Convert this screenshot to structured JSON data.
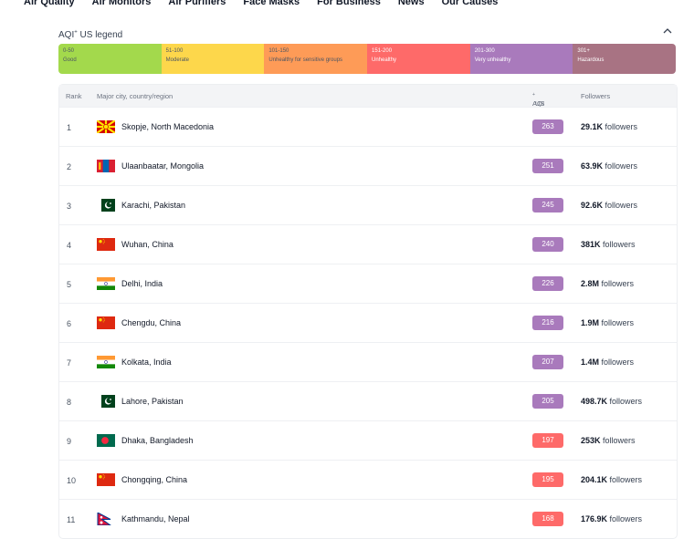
{
  "nav": [
    "Air Quality",
    "Air Monitors",
    "Air Purifiers",
    "Face Masks",
    "For Business",
    "News",
    "Our Causes"
  ],
  "legend": {
    "title": "AQI",
    "title_sup": "+",
    "title_suffix": " US legend",
    "segments": [
      {
        "range": "0-50",
        "label": "Good",
        "color": "#a3d94c",
        "text": "light"
      },
      {
        "range": "51-100",
        "label": "Moderate",
        "color": "#fdd74b",
        "text": "light"
      },
      {
        "range": "101-150",
        "label": "Unhealthy for sensitive groups",
        "color": "#fe9b57",
        "text": "light"
      },
      {
        "range": "151-200",
        "label": "Unhealthy",
        "color": "#fe6a69",
        "text": "dark"
      },
      {
        "range": "201-300",
        "label": "Very unhealthy",
        "color": "#a97abc",
        "text": "dark"
      },
      {
        "range": "301+",
        "label": "Hazardous",
        "color": "#a87383",
        "text": "dark"
      }
    ]
  },
  "table": {
    "headers": {
      "rank": "Rank",
      "city": "Major city, country/region",
      "aqi": "AQI",
      "aqi_sup": "+",
      "aqi_suffix": " US",
      "followers": "Followers"
    },
    "followers_word": "followers",
    "rows": [
      {
        "rank": "1",
        "flag": "mk",
        "city": "Skopje, North Macedonia",
        "aqi": "263",
        "aqi_color": "#a97abc",
        "followers": "29.1K"
      },
      {
        "rank": "2",
        "flag": "mn",
        "city": "Ulaanbaatar, Mongolia",
        "aqi": "251",
        "aqi_color": "#a97abc",
        "followers": "63.9K"
      },
      {
        "rank": "3",
        "flag": "pk",
        "city": "Karachi, Pakistan",
        "aqi": "245",
        "aqi_color": "#a97abc",
        "followers": "92.6K"
      },
      {
        "rank": "4",
        "flag": "cn",
        "city": "Wuhan, China",
        "aqi": "240",
        "aqi_color": "#a97abc",
        "followers": "381K"
      },
      {
        "rank": "5",
        "flag": "in",
        "city": "Delhi, India",
        "aqi": "226",
        "aqi_color": "#a97abc",
        "followers": "2.8M"
      },
      {
        "rank": "6",
        "flag": "cn",
        "city": "Chengdu, China",
        "aqi": "216",
        "aqi_color": "#a97abc",
        "followers": "1.9M"
      },
      {
        "rank": "7",
        "flag": "in",
        "city": "Kolkata, India",
        "aqi": "207",
        "aqi_color": "#a97abc",
        "followers": "1.4M"
      },
      {
        "rank": "8",
        "flag": "pk",
        "city": "Lahore, Pakistan",
        "aqi": "205",
        "aqi_color": "#a97abc",
        "followers": "498.7K"
      },
      {
        "rank": "9",
        "flag": "bd",
        "city": "Dhaka, Bangladesh",
        "aqi": "197",
        "aqi_color": "#fe6a69",
        "followers": "253K"
      },
      {
        "rank": "10",
        "flag": "cn",
        "city": "Chongqing, China",
        "aqi": "195",
        "aqi_color": "#fe6a69",
        "followers": "204.1K"
      },
      {
        "rank": "11",
        "flag": "np",
        "city": "Kathmandu, Nepal",
        "aqi": "168",
        "aqi_color": "#fe6a69",
        "followers": "176.9K"
      }
    ]
  }
}
